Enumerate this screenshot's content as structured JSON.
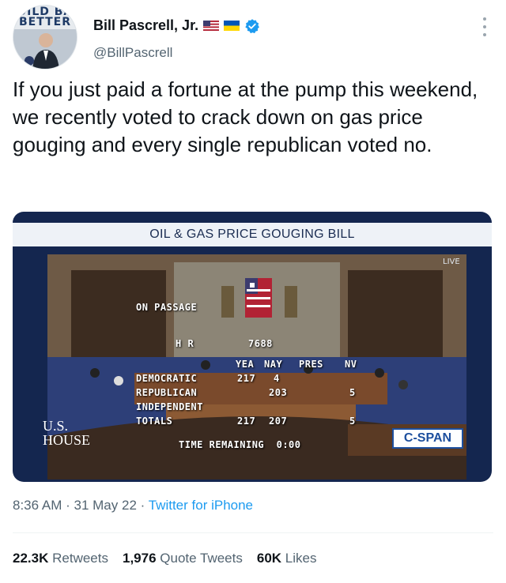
{
  "author": {
    "display_name": "Bill Pascrell, Jr.",
    "handle": "@BillPascrell",
    "avatar_banner": "UILD BA\nBETTER",
    "flags": [
      "us-flag-icon",
      "ukraine-flag-icon"
    ],
    "verified_icon": "verified-badge-icon"
  },
  "tweet": {
    "text": "If you just paid a fortune at the pump this weekend, we recently voted to crack down on gas price gouging and every single republican voted no."
  },
  "media": {
    "title": "OIL & GAS PRICE GOUGING BILL",
    "live": "LIVE",
    "on_passage": "ON PASSAGE",
    "bill": "H R",
    "bill_number": "7688",
    "columns": [
      "YEA",
      "NAY",
      "PRES",
      "NV"
    ],
    "rows": [
      {
        "party": "DEMOCRATIC",
        "yea": "217",
        "nay": "4",
        "nv": ""
      },
      {
        "party": "REPUBLICAN",
        "yea": "",
        "nay": "203",
        "nv": "5"
      },
      {
        "party": "INDEPENDENT",
        "yea": "",
        "nay": "",
        "nv": ""
      },
      {
        "party": "TOTALS",
        "yea": "217",
        "nay": "207",
        "nv": "5"
      }
    ],
    "time_remaining": "TIME REMAINING  0:00",
    "house_logo_line1": "U.S.",
    "house_logo_line2": "HOUSE",
    "network_logo": "C-SPAN"
  },
  "meta": {
    "time": "8:36 AM",
    "sep1": "·",
    "date": "31 May 22",
    "sep2": "·",
    "source": "Twitter for iPhone"
  },
  "stats": {
    "retweets_count": "22.3K",
    "retweets_label": "Retweets",
    "quotes_count": "1,976",
    "quotes_label": "Quote Tweets",
    "likes_count": "60K",
    "likes_label": "Likes"
  },
  "colors": {
    "link": "#1d9bf0",
    "muted": "#536471",
    "text": "#0f1419",
    "verified": "#1d9bf0"
  }
}
